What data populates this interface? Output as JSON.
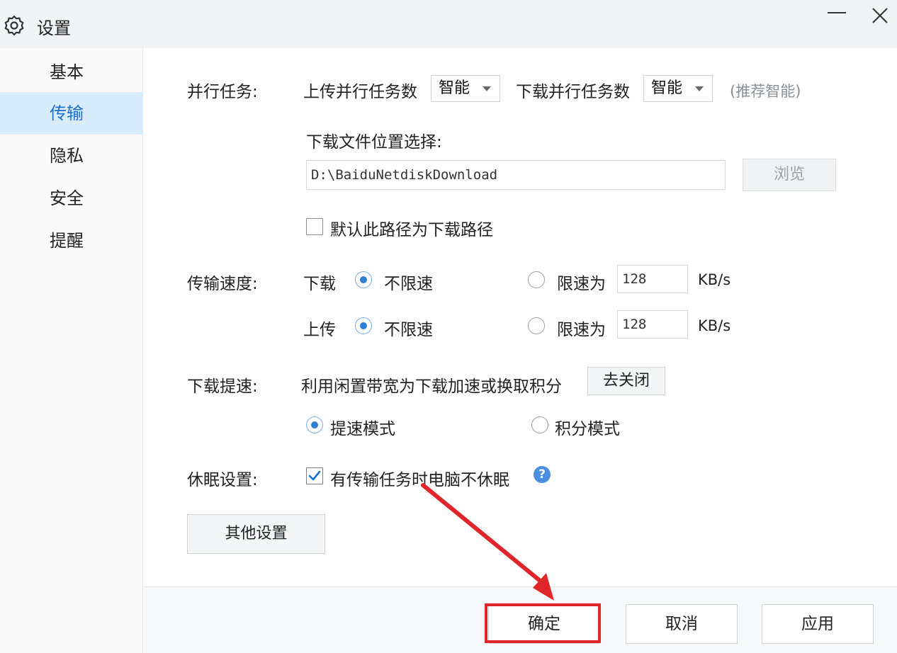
{
  "window": {
    "title": "设置"
  },
  "sidebar": {
    "items": [
      {
        "label": "基本"
      },
      {
        "label": "传输"
      },
      {
        "label": "隐私"
      },
      {
        "label": "安全"
      },
      {
        "label": "提醒"
      }
    ],
    "active_index": 1
  },
  "parallel": {
    "label": "并行任务:",
    "upload_label": "上传并行任务数",
    "upload_value": "智能",
    "download_label": "下载并行任务数",
    "download_value": "智能",
    "hint": "(推荐智能)"
  },
  "download_location": {
    "label": "下载文件位置选择:",
    "path": "D:\\BaiduNetdiskDownload",
    "browse_label": "浏览",
    "default_checkbox_label": "默认此路径为下载路径",
    "default_checked": false
  },
  "speed": {
    "label": "传输速度:",
    "rows": [
      {
        "direction": "下载",
        "unlimited_label": "不限速",
        "limit_label": "限速为",
        "limit_value": "128",
        "unit": "KB/s",
        "selected": "unlimited"
      },
      {
        "direction": "上传",
        "unlimited_label": "不限速",
        "limit_label": "限速为",
        "limit_value": "128",
        "unit": "KB/s",
        "selected": "unlimited"
      }
    ]
  },
  "boost": {
    "label": "下载提速:",
    "description": "利用闲置带宽为下载加速或换取积分",
    "close_button": "去关闭",
    "mode_speed": "提速模式",
    "mode_points": "积分模式",
    "selected": "speed"
  },
  "sleep": {
    "label": "休眠设置:",
    "checkbox_label": "有传输任务时电脑不休眠",
    "checked": true,
    "help_icon": "?"
  },
  "other_settings_label": "其他设置",
  "footer": {
    "ok": "确定",
    "cancel": "取消",
    "apply": "应用"
  },
  "colors": {
    "accent": "#2d7fd3",
    "active_nav_bg": "#d8ecfb",
    "annotation": "#e0262a"
  }
}
